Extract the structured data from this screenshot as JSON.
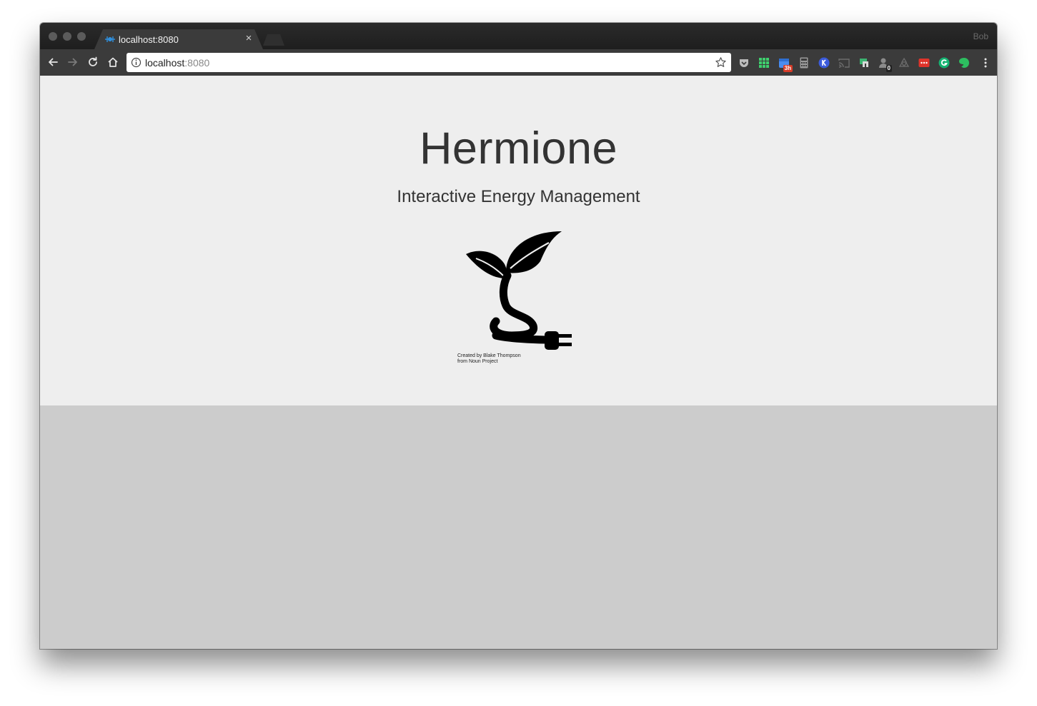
{
  "browser": {
    "tab_title": "localhost:8080",
    "tab_close": "×",
    "profile_name": "Bob",
    "url_host": "localhost",
    "url_port": ":8080"
  },
  "extensions": [
    {
      "icon": "pocket-icon"
    },
    {
      "icon": "grid-apps-icon"
    },
    {
      "icon": "calendar-icon",
      "badge": "3h"
    },
    {
      "icon": "calculator-icon"
    },
    {
      "icon": "k-circle-icon"
    },
    {
      "icon": "cast-icon"
    },
    {
      "icon": "tag-icon"
    },
    {
      "icon": "lock-person-icon",
      "badge": "0"
    },
    {
      "icon": "recycle-icon"
    },
    {
      "icon": "red-dots-icon"
    },
    {
      "icon": "grammarly-icon"
    },
    {
      "icon": "evernote-icon"
    }
  ],
  "hero": {
    "title": "Hermione",
    "subtitle": "Interactive Energy Management",
    "credit_line1": "Created by Blake Thompson",
    "credit_line2": "from Noun Project"
  },
  "colors": {
    "hero_bg": "#eeeeee",
    "page_bg": "#cccccc",
    "text": "#333333"
  }
}
